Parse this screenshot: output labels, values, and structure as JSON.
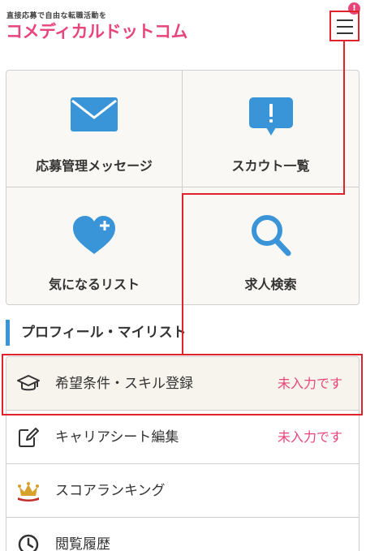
{
  "header": {
    "tagline": "直接応募で自由な転職活動を",
    "logo": "コメディカルドットコム",
    "notification_badge": "!"
  },
  "menu_grid": [
    {
      "label": "応募管理メッセージ",
      "icon": "mail-icon"
    },
    {
      "label": "スカウト一覧",
      "icon": "speech-bubble-exclamation-icon"
    },
    {
      "label": "気になるリスト",
      "icon": "heart-plus-icon"
    },
    {
      "label": "求人検索",
      "icon": "magnifier-icon"
    }
  ],
  "section": {
    "title": "プロフィール・マイリスト"
  },
  "list": [
    {
      "label": "希望条件・スキル登録",
      "status": "未入力です",
      "icon": "graduation-cap-icon",
      "highlighted": true
    },
    {
      "label": "キャリアシート編集",
      "status": "未入力です",
      "icon": "edit-icon"
    },
    {
      "label": "スコアランキング",
      "status": "",
      "icon": "crown-icon"
    },
    {
      "label": "閲覧履歴",
      "status": "",
      "icon": "clock-icon"
    }
  ],
  "colors": {
    "brand_pink": "#e8457a",
    "accent_blue": "#3a95d8",
    "highlight_red": "#e0232b",
    "tile_background": "#faf8f4"
  }
}
